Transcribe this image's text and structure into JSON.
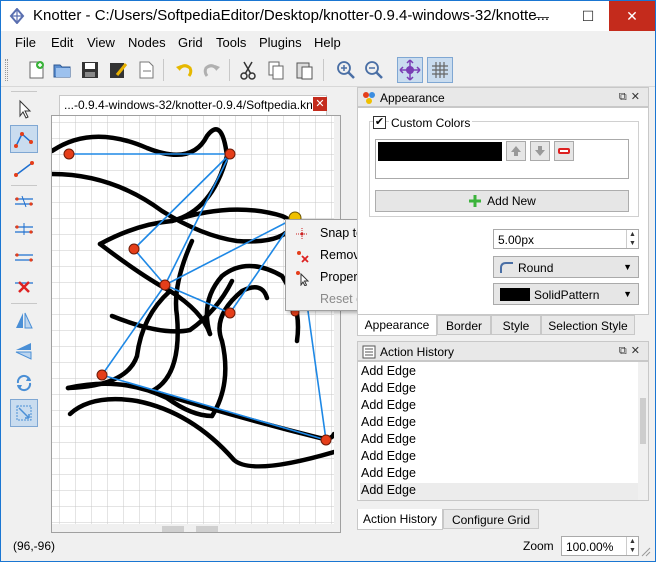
{
  "window": {
    "title": "Knotter - C:/Users/SoftpediaEditor/Desktop/knotter-0.9.4-windows-32/knotte...",
    "minimize": "—",
    "maximize": "☐",
    "close": "✕"
  },
  "menu": [
    "File",
    "Edit",
    "View",
    "Nodes",
    "Grid",
    "Tools",
    "Plugins",
    "Help"
  ],
  "document": {
    "tab_label": "...-0.9.4-windows-32/knotter-0.9.4/Softpedia.knot",
    "close": "✕"
  },
  "context_menu": {
    "items": [
      {
        "label": "Snap to grid",
        "enabled": true
      },
      {
        "label": "Remove",
        "enabled": true
      },
      {
        "label": "Properties...",
        "enabled": true
      },
      {
        "label": "Reset custom style",
        "enabled": false
      }
    ]
  },
  "appearance": {
    "title": "Appearance",
    "custom_colors_label": "Custom Colors",
    "custom_colors_checked": true,
    "colors": [
      "#000000"
    ],
    "add_new_label": "Add New",
    "width_value": "5.00px",
    "cusp_style": "Round",
    "pattern": "SolidPattern",
    "tabs": [
      "Appearance",
      "Border",
      "Style",
      "Selection Style"
    ],
    "active_tab": 0
  },
  "action_history": {
    "title": "Action History",
    "items": [
      "Add Edge",
      "Add Edge",
      "Add Edge",
      "Add Edge",
      "Add Edge",
      "Add Edge",
      "Add Edge",
      "Add Edge"
    ],
    "selected_index": 7,
    "tabs": [
      "Action History",
      "Configure Grid"
    ],
    "active_tab": 0
  },
  "status": {
    "coords": "(96,-96)",
    "zoom_label": "Zoom",
    "zoom_value": "100.00%"
  },
  "colors": {
    "accent": "#1a76d2",
    "edge_line": "#1e88e5",
    "node_fill": "#e53e1a",
    "knot": "#000000",
    "close_red": "#c42b1c"
  }
}
